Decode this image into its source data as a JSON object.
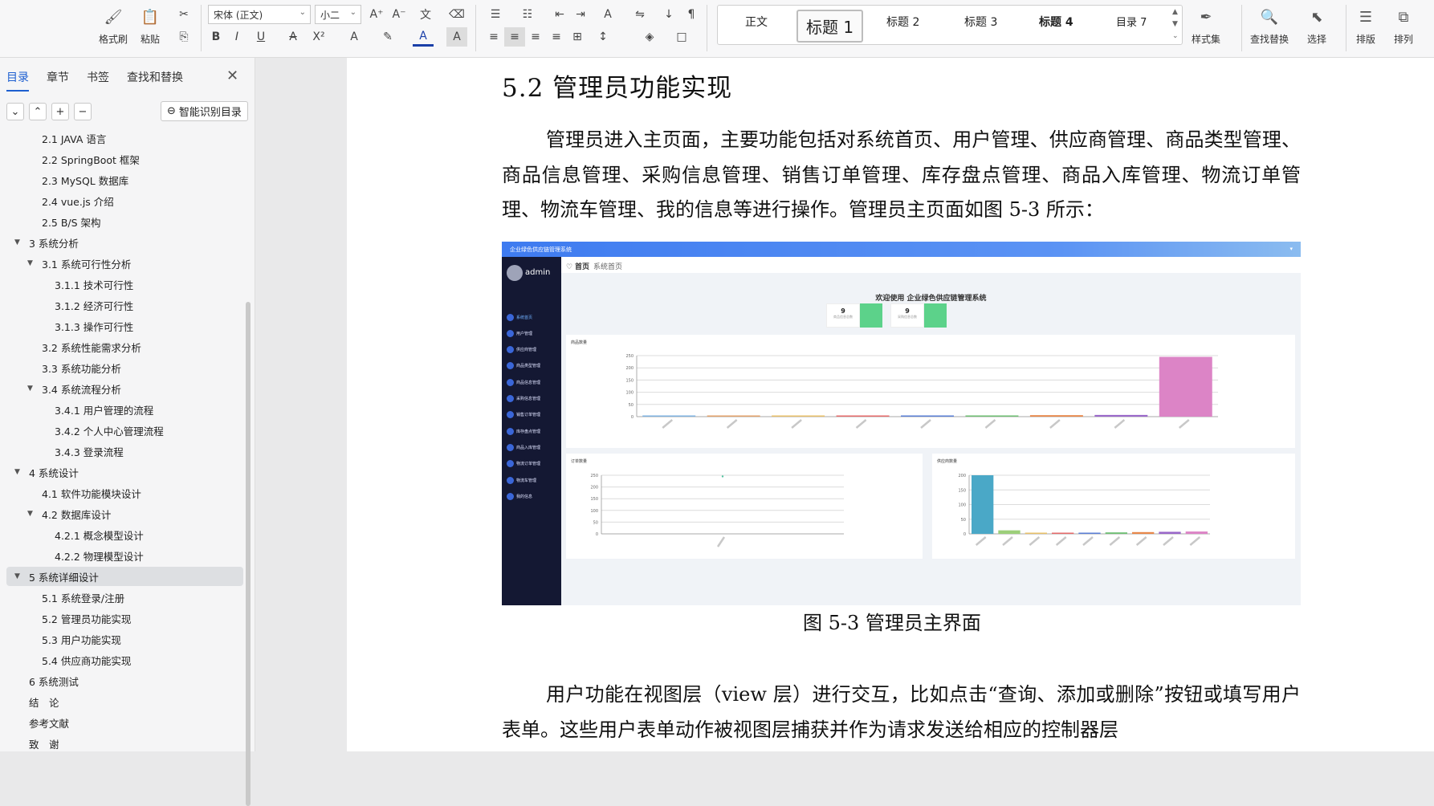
{
  "ribbon": {
    "format_brush": "格式刷",
    "paste": "粘贴",
    "font_name": "宋体 (正文)",
    "font_size": "小二",
    "style_gallery": [
      "正文",
      "标题 1",
      "标题 2",
      "标题 3",
      "标题 4",
      "目录 7"
    ],
    "style_set": "样式集",
    "find_replace": "查找替换",
    "select": "选择",
    "layout": "排版",
    "arrange": "排列"
  },
  "nav": {
    "tabs": [
      "目录",
      "章节",
      "书签",
      "查找和替换"
    ],
    "smart_toc": "智能识别目录",
    "items": [
      {
        "label": "2.1 JAVA 语言",
        "level": 2
      },
      {
        "label": "2.2 SpringBoot 框架",
        "level": 2
      },
      {
        "label": "2.3 MySQL 数据库",
        "level": 2
      },
      {
        "label": "2.4 vue.js 介绍",
        "level": 2
      },
      {
        "label": "2.5 B/S 架构",
        "level": 2
      },
      {
        "label": "3 系统分析",
        "level": 1,
        "toggle": "▼"
      },
      {
        "label": "3.1 系统可行性分析",
        "level": 2,
        "toggle": "▼"
      },
      {
        "label": "3.1.1 技术可行性",
        "level": 3
      },
      {
        "label": "3.1.2 经济可行性",
        "level": 3
      },
      {
        "label": "3.1.3 操作可行性",
        "level": 3
      },
      {
        "label": "3.2 系统性能需求分析",
        "level": 2
      },
      {
        "label": "3.3 系统功能分析",
        "level": 2
      },
      {
        "label": "3.4 系统流程分析",
        "level": 2,
        "toggle": "▼"
      },
      {
        "label": "3.4.1 用户管理的流程",
        "level": 3
      },
      {
        "label": "3.4.2 个人中心管理流程",
        "level": 3
      },
      {
        "label": "3.4.3 登录流程",
        "level": 3
      },
      {
        "label": "4 系统设计",
        "level": 1,
        "toggle": "▼"
      },
      {
        "label": "4.1 软件功能模块设计",
        "level": 2
      },
      {
        "label": "4.2 数据库设计",
        "level": 2,
        "toggle": "▼"
      },
      {
        "label": "4.2.1 概念模型设计",
        "level": 3
      },
      {
        "label": "4.2.2 物理模型设计",
        "level": 3
      },
      {
        "label": "5 系统详细设计",
        "level": 1,
        "toggle": "▼",
        "active": true
      },
      {
        "label": "5.1 系统登录/注册",
        "level": 2
      },
      {
        "label": "5.2 管理员功能实现",
        "level": 2
      },
      {
        "label": "5.3 用户功能实现",
        "level": 2
      },
      {
        "label": "5.4 供应商功能实现",
        "level": 2
      },
      {
        "label": "6 系统测试",
        "level": 1
      },
      {
        "label": "结　论",
        "level": 1
      },
      {
        "label": "参考文献",
        "level": 1
      },
      {
        "label": "致　谢",
        "level": 1
      }
    ]
  },
  "doc": {
    "heading": "5.2 管理员功能实现",
    "para1": "管理员进入主页面，主要功能包括对系统首页、用户管理、供应商管理、商品类型管理、商品信息管理、采购信息管理、销售订单管理、库存盘点管理、商品入库管理、物流订单管理、物流车管理、我的信息等进行操作。管理员主页面如图 5-3 所示：",
    "caption": "图 5-3 管理员主界面",
    "para2": "用户功能在视图层（view 层）进行交互，比如点击“查询、添加或删除”按钮或填写用户表单。这些用户表单动作被视图层捕获并作为请求发送给相应的控制器层"
  },
  "figure": {
    "app_title": "企业绿色供应链管理系统",
    "user": "admin",
    "breadcrumb_home": "首页",
    "breadcrumb_page": "系统首页",
    "welcome": "欢迎使用 企业绿色供应链管理系统",
    "stats": [
      {
        "value": "9",
        "label": "商品信息总数"
      },
      {
        "value": "9",
        "label": "采购信息总数"
      }
    ],
    "menu": [
      "系统首页",
      "用户管理",
      "供应商管理",
      "商品类型管理",
      "商品信息管理",
      "采购信息管理",
      "销售订单管理",
      "库存盘点管理",
      "商品入库管理",
      "物流订单管理",
      "物流车管理",
      "我的信息"
    ],
    "chart_titles": [
      "商品数量",
      "订单数量",
      "供应商数量"
    ]
  },
  "chart_data": [
    {
      "type": "bar",
      "title": "商品数量",
      "ylim": [
        0,
        250
      ],
      "yticks": [
        0,
        50,
        100,
        150,
        200,
        250
      ],
      "values": [
        1,
        1,
        2,
        3,
        4,
        5,
        6,
        7,
        245
      ],
      "colors": [
        "#7fb3e0",
        "#e3a26b",
        "#e8c06a",
        "#e66b6b",
        "#5b7fd6",
        "#6fbf73",
        "#e8884a",
        "#9a68c9",
        "#dc84c6"
      ]
    },
    {
      "type": "line",
      "title": "订单数量",
      "ylim": [
        0,
        250
      ],
      "yticks": [
        0,
        50,
        100,
        150,
        200,
        250
      ],
      "values": [
        245
      ]
    },
    {
      "type": "bar",
      "title": "供应商数量",
      "ylim": [
        0,
        200
      ],
      "yticks": [
        0,
        50,
        100,
        150,
        200
      ],
      "values": [
        200,
        12,
        2,
        3,
        4,
        5,
        6,
        7,
        8
      ],
      "colors": [
        "#4aa8c7",
        "#9ccf7a",
        "#e8c06a",
        "#e66b6b",
        "#5b7fd6",
        "#6fbf73",
        "#e8884a",
        "#9a68c9",
        "#dc84c6"
      ]
    }
  ],
  "colors": {
    "accent": "#1d5fd0",
    "sidebar_dark": "#141833"
  }
}
